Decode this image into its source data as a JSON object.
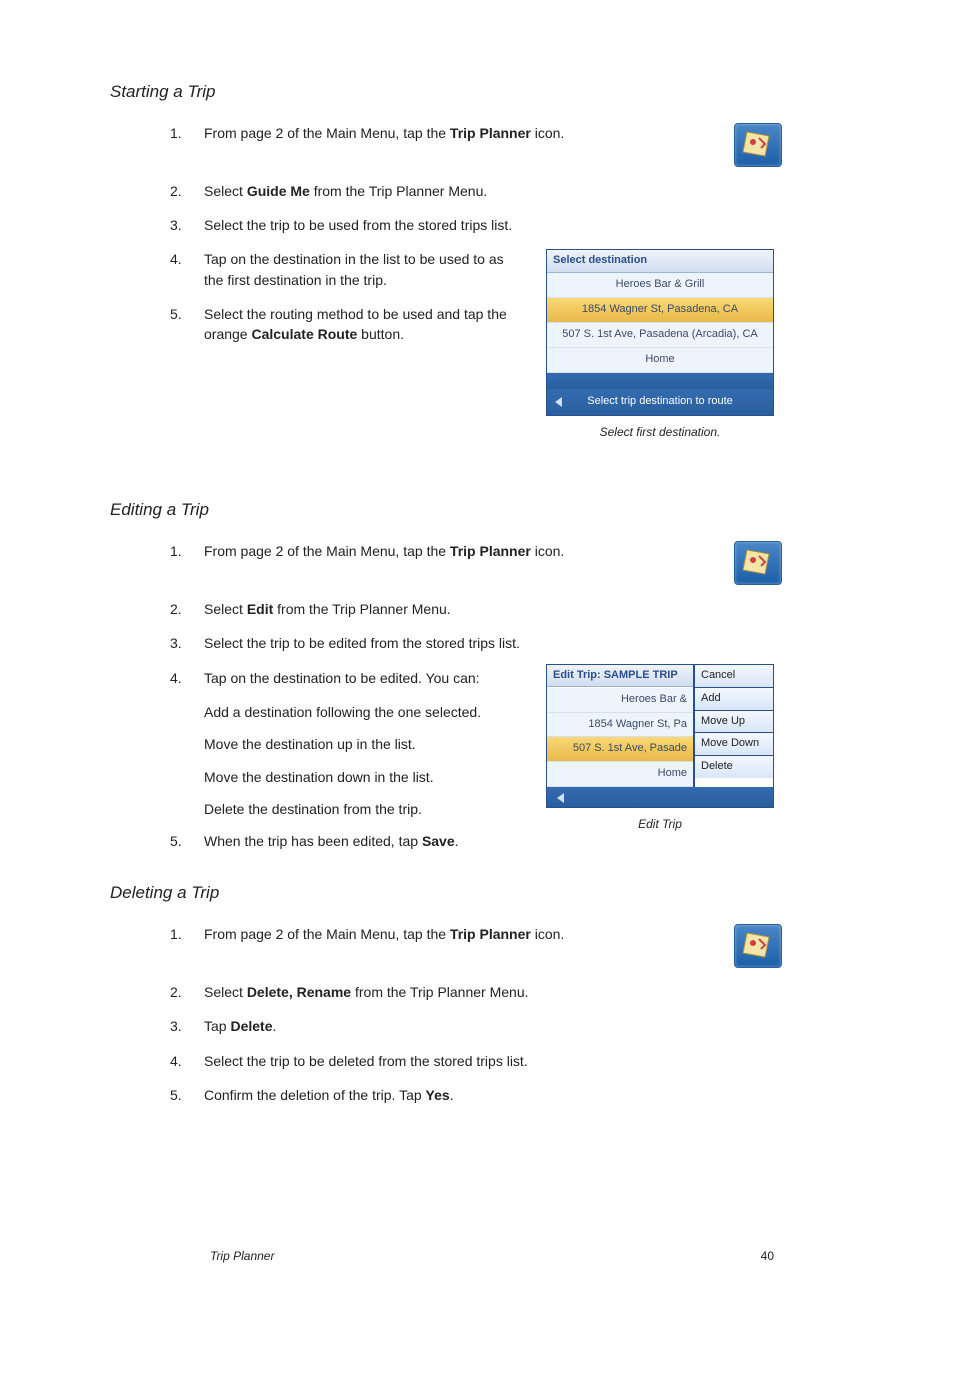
{
  "s1": {
    "title": "Starting a Trip",
    "items": [
      {
        "n": "1.",
        "pre": "From page 2 of the Main Menu, tap the ",
        "b": "Trip Planner",
        "post": " icon."
      },
      {
        "n": "2.",
        "pre": "Select ",
        "b": "Guide Me",
        "post": " from the Trip Planner Menu."
      },
      {
        "n": "3.",
        "pre": "Select the trip to be used from the stored trips list.",
        "b": "",
        "post": ""
      },
      {
        "n": "4.",
        "pre": "Tap on the destination in the list to be used to as the first destination in the trip.",
        "b": "",
        "post": ""
      },
      {
        "n": "5.",
        "pre": "Select the routing method to be used and tap the orange ",
        "b": "Calculate Route",
        "post": " button."
      }
    ]
  },
  "fig1": {
    "header": "Select destination",
    "rows": [
      "Heroes Bar & Grill",
      "1854 Wagner St, Pasadena, CA",
      "507 S. 1st Ave, Pasadena (Arcadia), CA",
      "Home"
    ],
    "selected_index": 1,
    "footer": "Select trip destination to route",
    "caption": "Select first destination."
  },
  "s2": {
    "title": "Editing a Trip",
    "items": [
      {
        "n": "1.",
        "pre": "From page 2 of the Main Menu, tap the ",
        "b": "Trip Planner",
        "post": " icon."
      },
      {
        "n": "2.",
        "pre": "Select ",
        "b": "Edit",
        "post": " from the Trip Planner Menu."
      },
      {
        "n": "3.",
        "pre": "Select the trip to be edited from the stored trips list.",
        "b": "",
        "post": ""
      },
      {
        "n": "4.",
        "pre": "Tap on the destination to be edited.  You can:",
        "b": "",
        "post": ""
      }
    ],
    "subs": [
      "Add a destination following the one selected.",
      "Move the destination up in the list.",
      "Move the destination down in the list.",
      "Delete the destination from the trip."
    ],
    "item5": {
      "n": "5.",
      "pre": "When the trip has been edited, tap ",
      "b": "Save",
      "post": "."
    }
  },
  "fig2": {
    "header": "Edit Trip: SAMPLE TRIP",
    "rows": [
      "Heroes Bar &",
      "1854 Wagner St, Pa",
      "507 S. 1st Ave, Pasade",
      "Home"
    ],
    "selected_index": 2,
    "menu": [
      "Cancel",
      "Add",
      "Move Up",
      "Move Down",
      "Delete"
    ],
    "caption": "Edit Trip"
  },
  "s3": {
    "title": "Deleting a Trip",
    "items": [
      {
        "n": "1.",
        "pre": "From page 2 of the Main Menu, tap the ",
        "b": "Trip Planner",
        "post": " icon."
      },
      {
        "n": "2.",
        "pre": "Select ",
        "b": "Delete, Rename",
        "post": " from the Trip Planner Menu."
      },
      {
        "n": "3.",
        "pre": "Tap ",
        "b": "Delete",
        "post": "."
      },
      {
        "n": "4.",
        "pre": "Select the trip to be deleted from the stored trips list.",
        "b": "",
        "post": ""
      },
      {
        "n": "5.",
        "pre": "Confirm the deletion of the trip.  Tap ",
        "b": "Yes",
        "post": "."
      }
    ]
  },
  "footer": {
    "left": "Trip Planner",
    "right": "40"
  }
}
